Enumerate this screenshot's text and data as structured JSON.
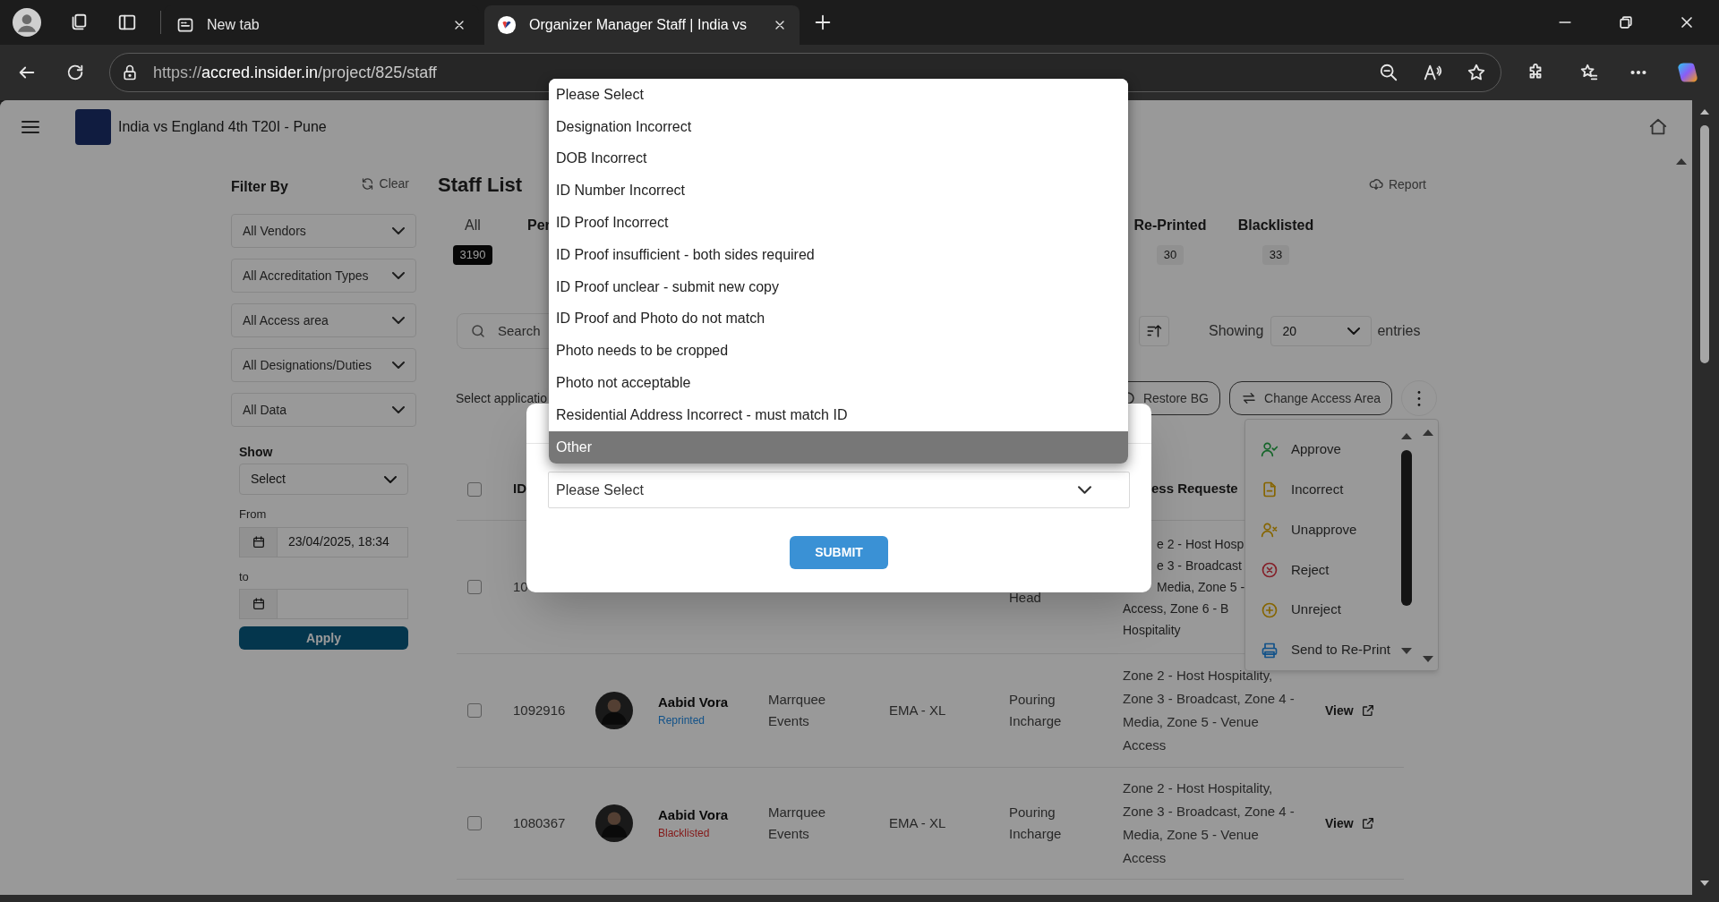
{
  "browser": {
    "tabs": [
      {
        "title": "New tab",
        "selected": false
      },
      {
        "title": "Organizer Manager Staff | India vs",
        "selected": true
      }
    ],
    "address": {
      "scheme": "https://",
      "host": "accred.insider.in",
      "path": "/project/825/staff"
    }
  },
  "header": {
    "event_title": "India vs England 4th T20I - Pune"
  },
  "filters": {
    "heading": "Filter By",
    "clear": "Clear",
    "dropdowns": [
      "All Vendors",
      "All Accreditation Types",
      "All Access area",
      "All Designations/Duties",
      "All Data"
    ],
    "show_label": "Show",
    "show_value": "Select",
    "from_label": "From",
    "from_value": "23/04/2025, 18:34",
    "to_label": "to",
    "apply": "Apply"
  },
  "staff_list": {
    "title": "Staff List",
    "report": "Report",
    "status_tabs": [
      {
        "label": "All",
        "count": "3190",
        "selected": true
      },
      {
        "label": "Per",
        "selected": false
      },
      {
        "label": "Re-Printed",
        "count": "30",
        "selected": false
      },
      {
        "label": "Blacklisted",
        "count": "33",
        "selected": false
      }
    ],
    "search": {
      "placeholder": "Search"
    },
    "showing": "Showing",
    "page_size": "20",
    "entries": "entries",
    "selection_hint": "Select applicatio",
    "actions": [
      "Restore BG",
      "Change Access Area"
    ],
    "action_menu": [
      {
        "kind": "approve",
        "label": "Approve",
        "color": "#146529"
      },
      {
        "kind": "incorrect",
        "label": "Incorrect",
        "color": "#866500"
      },
      {
        "kind": "unapprove",
        "label": "Unapprove",
        "color": "#866500"
      },
      {
        "kind": "reject",
        "label": "Reject",
        "color": "#842029"
      },
      {
        "kind": "unreject",
        "label": "Unreject",
        "color": "#866500"
      },
      {
        "kind": "reprint",
        "label": "Send to Re-Print",
        "color": "#125289"
      }
    ],
    "table": {
      "columns": {
        "id": "ID",
        "access": "ess Requeste"
      },
      "header_checked": false,
      "rows": [
        {
          "checked": false,
          "id": "10",
          "designation": "Head",
          "access_lines": [
            {
              "text": "e 2 - Host Hosp",
              "partly_hidden": true
            },
            {
              "text": "e 3 - Broadcast",
              "partly_hidden": true
            },
            {
              "text": "Media, Zone 5 -",
              "partly_hidden": true
            },
            {
              "text": "Access, Zone 6 - B"
            },
            {
              "text": "Hospitality"
            }
          ]
        },
        {
          "checked": false,
          "id": "1092916",
          "name": "Aabid Vora",
          "status": "Reprinted",
          "color": "#125289",
          "vendor": "Marrquee Events",
          "accreditation": "EMA - XL",
          "designation": "Pouring Incharge",
          "access": "Zone 2 - Host Hospitality, Zone 3 - Broadcast, Zone 4 - Media, Zone 5 - Venue Access",
          "view": "View"
        },
        {
          "checked": false,
          "id": "1080367",
          "name": "Aabid Vora",
          "status": "Blacklisted",
          "color": "#841717",
          "vendor": "Marrquee Events",
          "accreditation": "EMA - XL",
          "designation": "Pouring Incharge",
          "access": "Zone 2 - Host Hospitality, Zone 3 - Broadcast, Zone 4 - Media, Zone 5 - Venue Access",
          "view": "View"
        }
      ]
    }
  },
  "modal": {
    "select_value": "Please Select",
    "submit": "SUBMIT",
    "options": [
      {
        "label": "Please Select",
        "selected": false
      },
      {
        "label": "Designation Incorrect",
        "selected": false
      },
      {
        "label": "DOB Incorrect",
        "selected": false
      },
      {
        "label": "ID Number Incorrect",
        "selected": false
      },
      {
        "label": "ID Proof Incorrect",
        "selected": false
      },
      {
        "label": "ID Proof insufficient - both sides required",
        "selected": false
      },
      {
        "label": "ID Proof unclear - submit new copy",
        "selected": false
      },
      {
        "label": "ID Proof and Photo do not match",
        "selected": false
      },
      {
        "label": "Photo needs to be cropped",
        "selected": false
      },
      {
        "label": "Photo not acceptable",
        "selected": false
      },
      {
        "label": "Residential Address Incorrect - must match ID",
        "selected": false
      },
      {
        "label": "Other",
        "selected": true
      }
    ]
  }
}
